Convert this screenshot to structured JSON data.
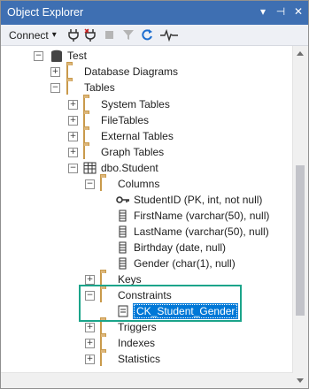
{
  "window": {
    "title": "Object Explorer"
  },
  "titlebar_icons": {
    "dropdown": "▾",
    "pin": "⊣",
    "close": "✕"
  },
  "toolbar": {
    "connect_label": "Connect",
    "connect_caret": "▾"
  },
  "tree": {
    "server": "Test",
    "database_diagrams": "Database Diagrams",
    "tables": "Tables",
    "system_tables": "System Tables",
    "file_tables": "FileTables",
    "external_tables": "External Tables",
    "graph_tables": "Graph Tables",
    "dbo_student": "dbo.Student",
    "columns": "Columns",
    "col_studentid": "StudentID (PK, int, not null)",
    "col_firstname": "FirstName (varchar(50), null)",
    "col_lastname": "LastName (varchar(50), null)",
    "col_birthday": "Birthday (date, null)",
    "col_gender": "Gender (char(1), null)",
    "keys": "Keys",
    "constraints": "Constraints",
    "ck_student_gender": "CK_Student_Gender",
    "triggers": "Triggers",
    "indexes": "Indexes",
    "statistics": "Statistics"
  },
  "expander": {
    "plus": "+",
    "minus": "−"
  },
  "colors": {
    "titlebar": "#3e6fb2",
    "selection": "#0078d7",
    "highlight_box": "#1ba48a",
    "folder": "#dcb67a"
  }
}
